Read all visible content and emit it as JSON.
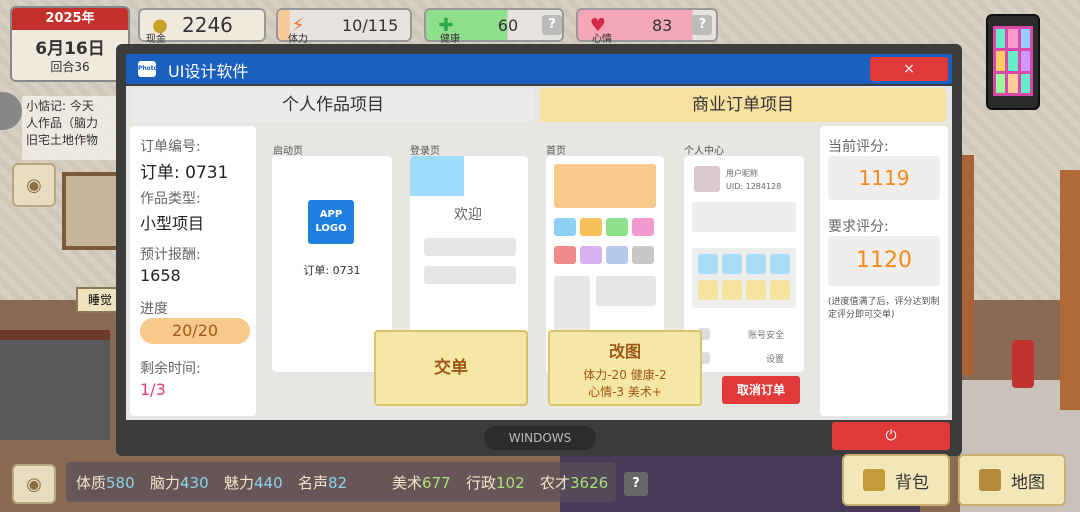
{
  "hud": {
    "year": "2025年",
    "date": "6月16日",
    "turn": "回合36",
    "cash_label": "现金",
    "cash": "2246",
    "stamina_label": "体力",
    "stamina": "10/115",
    "health_label": "健康",
    "health": "60",
    "mood_label": "心情",
    "mood": "83",
    "help": "?"
  },
  "notes": {
    "line1": "小惦记: 今天",
    "line2": "人作品（脑力",
    "line3": "旧宅土地作物"
  },
  "scene": {
    "sleep_label": "睡觉"
  },
  "window": {
    "logo": "Photo",
    "title": "UI设计软件",
    "close": "×",
    "tab_personal": "个人作品项目",
    "tab_commercial": "商业订单项目",
    "footer": "WINDOWS",
    "power": "⏻"
  },
  "order": {
    "id_label": "订单编号:",
    "id": "订单: 0731",
    "type_label": "作品类型:",
    "type": "小型项目",
    "reward_label": "预计报酬:",
    "reward": "1658",
    "progress_label": "进度",
    "progress": "20/20",
    "time_label": "剩余时间:",
    "time": "1/3"
  },
  "screens": {
    "splash_label": "启动页",
    "splash_logo": "APP LOGO",
    "splash_order": "订单: 0731",
    "login_label": "登录页",
    "login_welcome": "欢迎",
    "home_label": "首页",
    "profile_label": "个人中心",
    "profile_nick": "用户昵称",
    "profile_uid": "UID: 1284128",
    "profile_security": "账号安全",
    "profile_settings": "设置"
  },
  "actions": {
    "submit": "交单",
    "revise": "改图",
    "revise_cost1": "体力-20 健康-2",
    "revise_cost2": "心情-3 美术+",
    "cancel": "取消订单"
  },
  "scores": {
    "current_label": "当前评分:",
    "current": "1119",
    "required_label": "要求评分:",
    "required": "1120",
    "hint": "(进度值满了后，评分达到制定评分即可交单)"
  },
  "attributes": {
    "constitution_label": "体质",
    "constitution": "580",
    "brain_label": "脑力",
    "brain": "430",
    "charm_label": "魅力",
    "charm": "440",
    "fame_label": "名声",
    "fame": "82",
    "art_label": "美术",
    "art": "677",
    "admin_label": "行政",
    "admin": "102",
    "farm_label": "农才",
    "farm": "3626",
    "help": "?"
  },
  "buttons": {
    "bag": "背包",
    "map": "地图"
  },
  "colors": {
    "accent_blue": "#1b5fbf",
    "close_red": "#e2393b",
    "score_orange": "#f08a1c",
    "time_pink": "#e03a7a"
  }
}
